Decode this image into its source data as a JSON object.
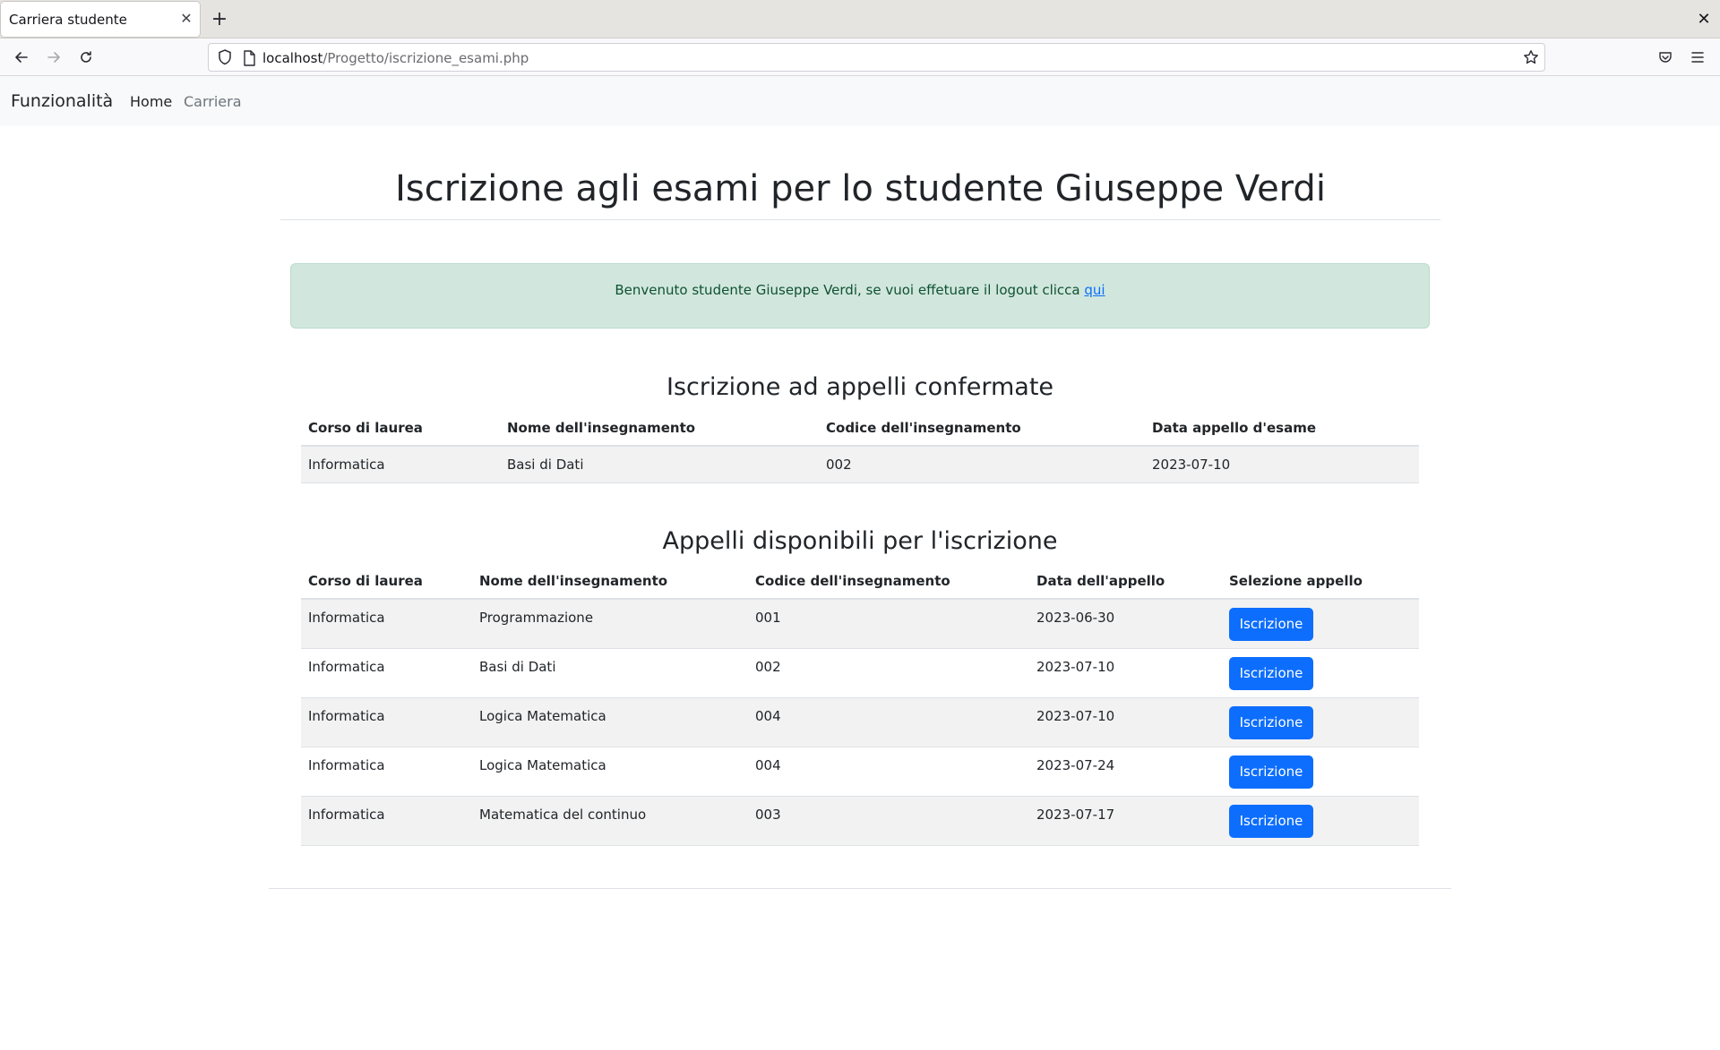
{
  "browser": {
    "tab_title": "Carriera studente",
    "tab_close": "✕",
    "new_tab": "+",
    "window_close": "✕",
    "url_host": "localhost",
    "url_path": "/Progetto/iscrizione_esami.php",
    "icons": [
      "back-arrow-icon",
      "forward-arrow-icon",
      "reload-icon",
      "shield-icon",
      "page-icon",
      "star-icon",
      "pocket-icon",
      "menu-icon"
    ]
  },
  "navbar": {
    "brand": "Funzionalità",
    "links": [
      {
        "label": "Home"
      },
      {
        "label": "Carriera"
      }
    ]
  },
  "main": {
    "title": "Iscrizione agli esami per lo studente Giuseppe Verdi",
    "alert": {
      "text": "Benvenuto studente Giuseppe Verdi, se vuoi effetuare il logout clicca ",
      "link": "qui"
    },
    "confirmed": {
      "title": "Iscrizione ad appelli confermate",
      "headers": [
        "Corso di laurea",
        "Nome dell'insegnamento",
        "Codice dell'insegnamento",
        "Data appello d'esame"
      ],
      "rows": [
        [
          "Informatica",
          "Basi di Dati",
          "002",
          "2023-07-10"
        ]
      ]
    },
    "available": {
      "title": "Appelli disponibili per l'iscrizione",
      "headers": [
        "Corso di laurea",
        "Nome dell'insegnamento",
        "Codice dell'insegnamento",
        "Data dell'appello",
        "Selezione appello"
      ],
      "button_label": "Iscrizione",
      "rows": [
        [
          "Informatica",
          "Programmazione",
          "001",
          "2023-06-30"
        ],
        [
          "Informatica",
          "Basi di Dati",
          "002",
          "2023-07-10"
        ],
        [
          "Informatica",
          "Logica Matematica",
          "004",
          "2023-07-10"
        ],
        [
          "Informatica",
          "Logica Matematica",
          "004",
          "2023-07-24"
        ],
        [
          "Informatica",
          "Matematica del continuo",
          "003",
          "2023-07-17"
        ]
      ]
    }
  },
  "colors": {
    "primary": "#0d6efd",
    "alert_bg": "#d1e7dd",
    "alert_text": "#0f5132",
    "stripe": "#f2f2f2"
  }
}
